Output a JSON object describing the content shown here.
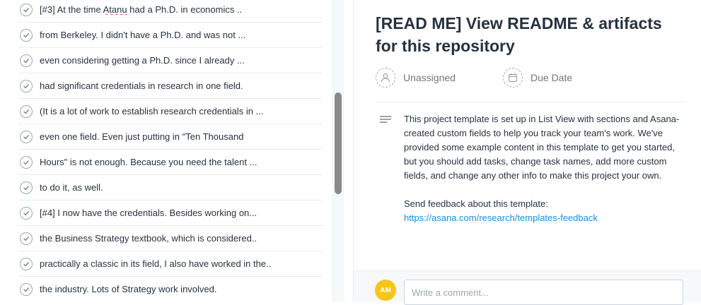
{
  "task_list": {
    "items": [
      {
        "parts": [
          {
            "text": "[#3] At the time ",
            "spell": false
          },
          {
            "text": "Atanu",
            "spell": true
          },
          {
            "text": " had a Ph.D. in economics ..",
            "spell": false
          }
        ]
      },
      {
        "parts": [
          {
            "text": "from Berkeley. I didn't have a Ph.D. and was not ...",
            "spell": false
          }
        ]
      },
      {
        "parts": [
          {
            "text": "even considering getting a Ph.D. since I already ...",
            "spell": false
          }
        ]
      },
      {
        "parts": [
          {
            "text": "had significant credentials in research in one field.",
            "spell": false
          }
        ]
      },
      {
        "parts": [
          {
            "text": "(It is a lot of work to establish research credentials in ...",
            "spell": false
          }
        ]
      },
      {
        "parts": [
          {
            "text": "even one field. Even just putting in \"Ten Thousand",
            "spell": false
          }
        ]
      },
      {
        "parts": [
          {
            "text": "Hours\" is not enough. Because you need the talent ...",
            "spell": false
          }
        ]
      },
      {
        "parts": [
          {
            "text": "to do it, as well.",
            "spell": false
          }
        ]
      },
      {
        "parts": [
          {
            "text": "[#4] I now have the credentials. Besides working on...",
            "spell": false
          }
        ]
      },
      {
        "parts": [
          {
            "text": "the Business Strategy textbook, which is considered..",
            "spell": false
          }
        ]
      },
      {
        "parts": [
          {
            "text": "practically a classic in its field, I also have worked in the..",
            "spell": false
          }
        ]
      },
      {
        "parts": [
          {
            "text": "the industry. Lots of Strategy work involved.",
            "spell": false
          }
        ]
      }
    ]
  },
  "details": {
    "title": "[READ ME] View README & artifacts for this repository",
    "assignee_label": "Unassigned",
    "due_date_label": "Due Date",
    "description": {
      "paragraph": "This project template is set up in List View with sections and Asana-created custom fields to help you track your team's work. We've provided some example content in this template to get you started, but you should add tasks, change task names, add more custom fields, and change any other info to make this project your own.",
      "feedback_prompt": "Send feedback about this template:",
      "feedback_link": "https://asana.com/research/templates-feedback"
    }
  },
  "comment": {
    "avatar_initials": "AM",
    "placeholder": "Write a comment..."
  },
  "colors": {
    "link": "#1f8dd6",
    "avatar_bg": "#f5c518",
    "text": "#273240",
    "muted": "#6f7782"
  }
}
